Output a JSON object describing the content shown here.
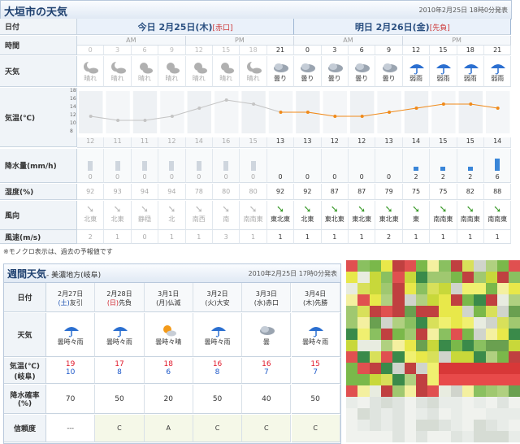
{
  "title": "大垣市の天気",
  "published": "2010年2月25日 18時0分発表",
  "labels": {
    "date": "日付",
    "time": "時間",
    "weather": "天気",
    "temp": "気温(℃)",
    "precip": "降水量(mm/h)",
    "humidity": "湿度(%)",
    "wind": "風向",
    "windspeed": "風速(m/s)"
  },
  "days": [
    {
      "label": "今日 2月25日(木)",
      "rokuyo": "[赤口]"
    },
    {
      "label": "明日 2月26日(金)",
      "rokuyo": "[先負]"
    }
  ],
  "ampm": [
    "AM",
    "PM",
    "AM",
    "PM"
  ],
  "hours": [
    "0",
    "3",
    "6",
    "9",
    "12",
    "15",
    "18",
    "21",
    "0",
    "3",
    "6",
    "9",
    "12",
    "15",
    "18",
    "21"
  ],
  "past_count": 7,
  "weather": [
    "晴れ",
    "晴れ",
    "晴れ",
    "晴れ",
    "晴れ",
    "晴れ",
    "晴れ",
    "曇り",
    "曇り",
    "曇り",
    "曇り",
    "曇り",
    "弱雨",
    "弱雨",
    "弱雨",
    "弱雨"
  ],
  "icon_types": [
    "moon",
    "moon",
    "sun",
    "sun",
    "sun",
    "sun",
    "moon",
    "cloud",
    "cloud",
    "cloud",
    "cloud",
    "cloud",
    "rain",
    "rain",
    "rain",
    "rain"
  ],
  "temp_series": [
    12,
    11,
    11,
    12,
    14,
    16,
    15,
    13,
    13,
    12,
    12,
    13,
    14,
    15,
    15,
    14
  ],
  "temp_axis_ticks": [
    18,
    16,
    14,
    12,
    10,
    8
  ],
  "temps": [
    "12",
    "11",
    "11",
    "12",
    "14",
    "16",
    "15",
    "13",
    "13",
    "12",
    "12",
    "13",
    "14",
    "15",
    "15",
    "14"
  ],
  "precip": [
    "0",
    "0",
    "0",
    "0",
    "0",
    "0",
    "0",
    "0",
    "0",
    "0",
    "0",
    "0",
    "2",
    "2",
    "2",
    "6"
  ],
  "humidity": [
    "92",
    "93",
    "94",
    "94",
    "78",
    "80",
    "80",
    "92",
    "92",
    "87",
    "87",
    "79",
    "75",
    "75",
    "82",
    "88"
  ],
  "wind": [
    "北東",
    "北東",
    "静穏",
    "北",
    "南西",
    "南",
    "南南東",
    "東北東",
    "北東",
    "東北東",
    "東北東",
    "東北東",
    "東",
    "南南東",
    "南南東",
    "南南東"
  ],
  "windspeed": [
    "2",
    "1",
    "0",
    "1",
    "1",
    "3",
    "1",
    "1",
    "1",
    "1",
    "1",
    "2",
    "1",
    "1",
    "1",
    "1"
  ],
  "note": "※モノクロ表示は、過去の予報値です",
  "weekly": {
    "title": "週間天気",
    "subtitle": "- 美濃地方(岐阜)",
    "published": "2010年2月25日 17時0分発表",
    "labels": {
      "date": "日付",
      "weather": "天気",
      "temp": "気温(℃)",
      "temp_sub": "(岐阜)",
      "precip": "降水確率",
      "precip_sub": "(%)",
      "reliability": "信頼度"
    },
    "days": [
      {
        "date": "2月27日",
        "dow": "(土)",
        "rokuyo": "友引",
        "weather": "曇時々雨",
        "hi": "19",
        "lo": "10",
        "pop": "70",
        "rel": "---",
        "dowclass": "sun",
        "icon": "rain"
      },
      {
        "date": "2月28日",
        "dow": "(日)",
        "rokuyo": "先負",
        "weather": "曇時々雨",
        "hi": "17",
        "lo": "8",
        "pop": "50",
        "rel": "C",
        "dowclass": "hol",
        "icon": "rain"
      },
      {
        "date": "3月1日",
        "dow": "(月)",
        "rokuyo": "仏滅",
        "weather": "曇時々晴",
        "hi": "18",
        "lo": "6",
        "pop": "20",
        "rel": "A",
        "dowclass": "",
        "icon": "sun"
      },
      {
        "date": "3月2日",
        "dow": "(火)",
        "rokuyo": "大安",
        "weather": "曇時々雨",
        "hi": "16",
        "lo": "8",
        "pop": "50",
        "rel": "C",
        "dowclass": "",
        "icon": "rain"
      },
      {
        "date": "3月3日",
        "dow": "(水)",
        "rokuyo": "赤口",
        "weather": "曇",
        "hi": "16",
        "lo": "7",
        "pop": "40",
        "rel": "C",
        "dowclass": "",
        "icon": "cloud"
      },
      {
        "date": "3月4日",
        "dow": "(木)",
        "rokuyo": "先勝",
        "weather": "曇時々雨",
        "hi": "15",
        "lo": "7",
        "pop": "50",
        "rel": "C",
        "dowclass": "",
        "icon": "rain"
      }
    ]
  },
  "colors": {
    "accent": "#1d3f6e",
    "temp_line": "#f08a1a",
    "past_line": "#c4c4c4",
    "rain": "#3a86d8"
  }
}
